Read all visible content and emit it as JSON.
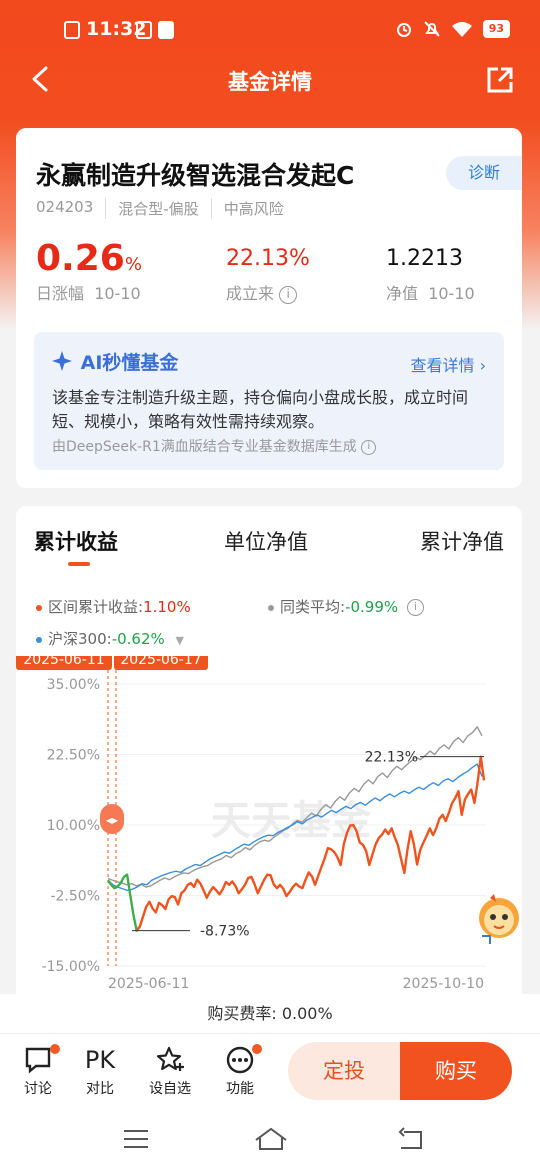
{
  "status_bar": {
    "time": "11:32",
    "battery": "93"
  },
  "nav": {
    "title": "基金详情"
  },
  "fund": {
    "name": "永赢制造升级智选混合发起C",
    "diagnose_label": "诊断",
    "code": "024203",
    "type": "混合型-偏股",
    "risk": "中高风险",
    "daily_change": "0.26",
    "daily_change_unit": "%",
    "daily_change_label": "日涨幅",
    "daily_change_date": "10-10",
    "since_inception": "22.13%",
    "since_inception_label": "成立来",
    "nav_value": "1.2213",
    "nav_label": "净值",
    "nav_date": "10-10"
  },
  "ai": {
    "title": "AI秒懂基金",
    "detail_link": "查看详情",
    "summary": "该基金专注制造升级主题，持仓偏向小盘成长股，成立时间短、规模小，策略有效性需持续观察。",
    "source": "由DeepSeek-R1满血版结合专业基金数据库生成"
  },
  "chart_tabs": [
    "累计收益",
    "单位净值",
    "累计净值"
  ],
  "legend": {
    "fund_label": "区间累计收益:",
    "fund_value": "1.10%",
    "peer_label": "同类平均:",
    "peer_value": "-0.99%",
    "index_label": "沪深300:",
    "index_value": "-0.62%"
  },
  "chart_data": {
    "type": "line",
    "markers": [
      "2025-06-11",
      "2025-06-17"
    ],
    "x_ticks": [
      "2025-06-11",
      "2025-10-10"
    ],
    "y_ticks": [
      "35.00%",
      "22.50%",
      "10.00%",
      "-2.50%",
      "-15.00%"
    ],
    "ylim": [
      -15,
      35
    ],
    "annotations": {
      "max": "22.13%",
      "min": "-8.73%"
    },
    "watermark": "天天基金",
    "series": [
      {
        "name": "区间累计收益",
        "color": "#f0541e",
        "values": [
          0.2,
          -0.6,
          -1.2,
          -0.9,
          -0.3,
          0.8,
          1.2,
          -2.5,
          -6.0,
          -8.73,
          -8.0,
          -6.2,
          -4.5,
          -3.6,
          -4.8,
          -5.5,
          -3.8,
          -4.2,
          -4.9,
          -3.2,
          -2.6,
          -2.8,
          -4.1,
          -2.1,
          -1.6,
          -0.6,
          -0.3,
          -1.0,
          0.3,
          -0.4,
          -1.6,
          -2.9,
          -1.8,
          -1.0,
          -1.6,
          -2.3,
          -1.4,
          -0.1,
          -0.6,
          0.0,
          -0.8,
          -2.1,
          -1.4,
          -0.6,
          0.6,
          0.8,
          -0.5,
          -2.1,
          -0.9,
          0.3,
          1.2,
          1.1,
          -0.5,
          -1.2,
          -0.6,
          -1.3,
          -2.6,
          -1.9,
          -1.0,
          -0.4,
          -0.9,
          -1.2,
          0.3,
          1.6,
          0.9,
          -0.6,
          1.0,
          2.6,
          4.1,
          5.9,
          5.7,
          5.2,
          4.3,
          2.9,
          6.6,
          8.6,
          9.9,
          10.0,
          8.9,
          6.9,
          6.5,
          5.4,
          2.9,
          4.8,
          6.6,
          7.7,
          8.3,
          9.2,
          8.4,
          9.4,
          7.8,
          6.4,
          3.9,
          1.5,
          5.7,
          8.9,
          6.6,
          3.0,
          5.6,
          6.9,
          8.1,
          9.4,
          8.2,
          9.4,
          11.1,
          11.8,
          10.7,
          12.2,
          13.9,
          14.8,
          16.0,
          11.8,
          14.5,
          15.5,
          16.3,
          13.9,
          17.6,
          22.1,
          17.9
        ]
      },
      {
        "name": "同类平均",
        "color": "#999999",
        "values": [
          0.5,
          0.2,
          -0.1,
          -0.3,
          -0.6,
          -0.4,
          -0.8,
          -0.5,
          -1.0,
          -0.8,
          -0.3,
          0.2,
          0.6,
          0.3,
          0.8,
          1.2,
          1.5,
          1.4,
          1.9,
          2.3,
          2.6,
          2.8,
          3.3,
          3.7,
          4.0,
          4.6,
          4.2,
          4.9,
          5.3,
          6.0,
          5.6,
          6.4,
          7.0,
          7.3,
          7.1,
          7.8,
          8.4,
          9.0,
          9.4,
          10.2,
          10.8,
          10.5,
          11.3,
          12.1,
          11.6,
          12.8,
          13.6,
          13.0,
          14.2,
          15.0,
          14.4,
          15.7,
          16.5,
          15.9,
          17.2,
          18.0,
          17.3,
          18.6,
          19.2,
          18.4,
          19.6,
          20.4,
          19.8,
          20.6,
          21.3,
          22.0,
          21.6,
          22.3,
          23.1,
          22.5,
          23.6,
          24.2,
          23.5,
          24.8,
          25.5,
          24.6,
          25.8,
          26.4,
          27.4,
          25.8
        ]
      },
      {
        "name": "沪深300",
        "color": "#3a8fdb",
        "values": [
          0.2,
          -0.6,
          -1.0,
          -1.3,
          -1.6,
          -1.4,
          -1.0,
          -0.4,
          -0.6,
          0.2,
          0.6,
          1.0,
          1.3,
          1.6,
          1.8,
          1.6,
          2.2,
          2.6,
          3.0,
          2.8,
          3.4,
          4.0,
          4.4,
          4.8,
          5.2,
          5.0,
          5.6,
          6.1,
          6.6,
          6.4,
          7.0,
          7.5,
          7.9,
          8.2,
          8.1,
          8.7,
          9.1,
          9.6,
          10.0,
          10.6,
          10.2,
          10.9,
          11.3,
          11.8,
          11.4,
          12.0,
          12.6,
          12.2,
          12.8,
          13.3,
          12.9,
          13.6,
          14.0,
          13.5,
          14.2,
          14.8,
          14.3,
          15.0,
          15.5,
          15.0,
          15.6,
          16.0,
          15.6,
          16.2,
          16.7,
          16.3,
          17.0,
          17.5,
          17.0,
          17.8,
          18.2,
          17.7,
          18.4,
          19.0,
          19.5,
          20.2,
          20.8,
          18.6
        ]
      }
    ]
  },
  "fee": "购买费率: 0.00%",
  "bottom": {
    "discuss": "讨论",
    "pk_icon": "PK",
    "compare": "对比",
    "watchlist": "设自选",
    "functions": "功能",
    "auto_invest": "定投",
    "buy": "购买"
  }
}
